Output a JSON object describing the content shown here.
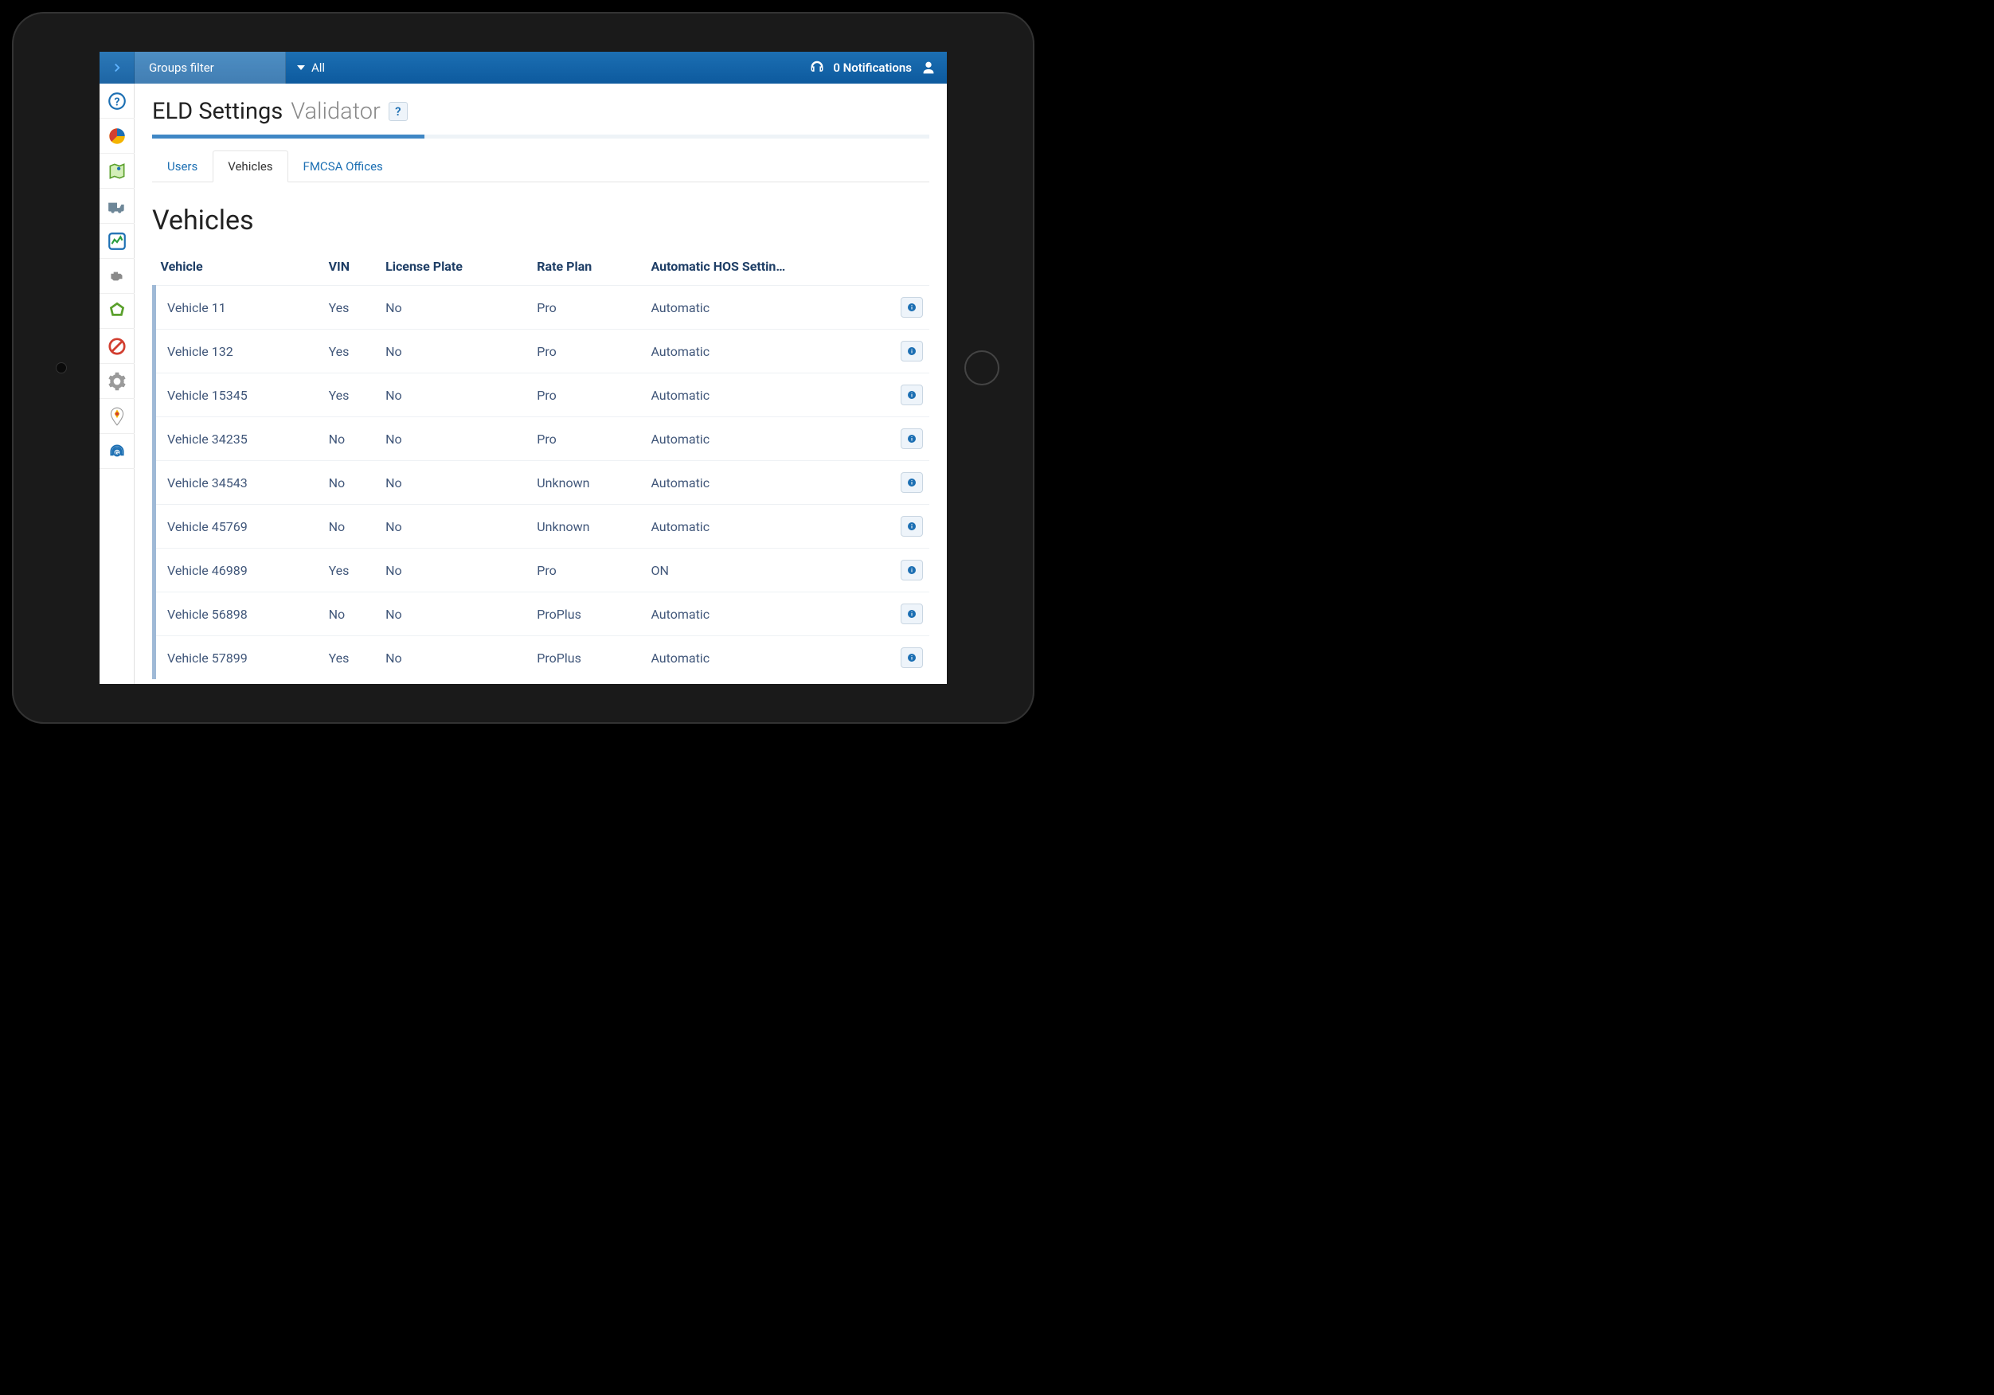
{
  "topbar": {
    "groups_filter": "Groups filter",
    "all_label": "All",
    "notifications": "0 Notifications"
  },
  "page": {
    "title_main": "ELD Settings",
    "title_sub": "Validator",
    "help_badge": "?"
  },
  "tabs": {
    "users": "Users",
    "vehicles": "Vehicles",
    "fmcsa": "FMCSA Offices"
  },
  "section": {
    "title": "Vehicles"
  },
  "table": {
    "headers": {
      "vehicle": "Vehicle",
      "vin": "VIN",
      "license": "License Plate",
      "rate": "Rate Plan",
      "hos": "Automatic HOS Settin…"
    },
    "rows": [
      {
        "vehicle": "Vehicle 11",
        "vin": "Yes",
        "license": "No",
        "rate": "Pro",
        "hos": "Automatic"
      },
      {
        "vehicle": "Vehicle 132",
        "vin": "Yes",
        "license": "No",
        "rate": "Pro",
        "hos": "Automatic"
      },
      {
        "vehicle": "Vehicle 15345",
        "vin": "Yes",
        "license": "No",
        "rate": "Pro",
        "hos": "Automatic"
      },
      {
        "vehicle": "Vehicle 34235",
        "vin": "No",
        "license": "No",
        "rate": "Pro",
        "hos": "Automatic"
      },
      {
        "vehicle": "Vehicle 34543",
        "vin": "No",
        "license": "No",
        "rate": "Unknown",
        "hos": "Automatic"
      },
      {
        "vehicle": "Vehicle 45769",
        "vin": "No",
        "license": "No",
        "rate": "Unknown",
        "hos": "Automatic"
      },
      {
        "vehicle": "Vehicle 46989",
        "vin": "Yes",
        "license": "No",
        "rate": "Pro",
        "hos": "ON"
      },
      {
        "vehicle": "Vehicle 56898",
        "vin": "No",
        "license": "No",
        "rate": "ProPlus",
        "hos": "Automatic"
      },
      {
        "vehicle": "Vehicle 57899",
        "vin": "Yes",
        "license": "No",
        "rate": "ProPlus",
        "hos": "Automatic"
      }
    ]
  }
}
